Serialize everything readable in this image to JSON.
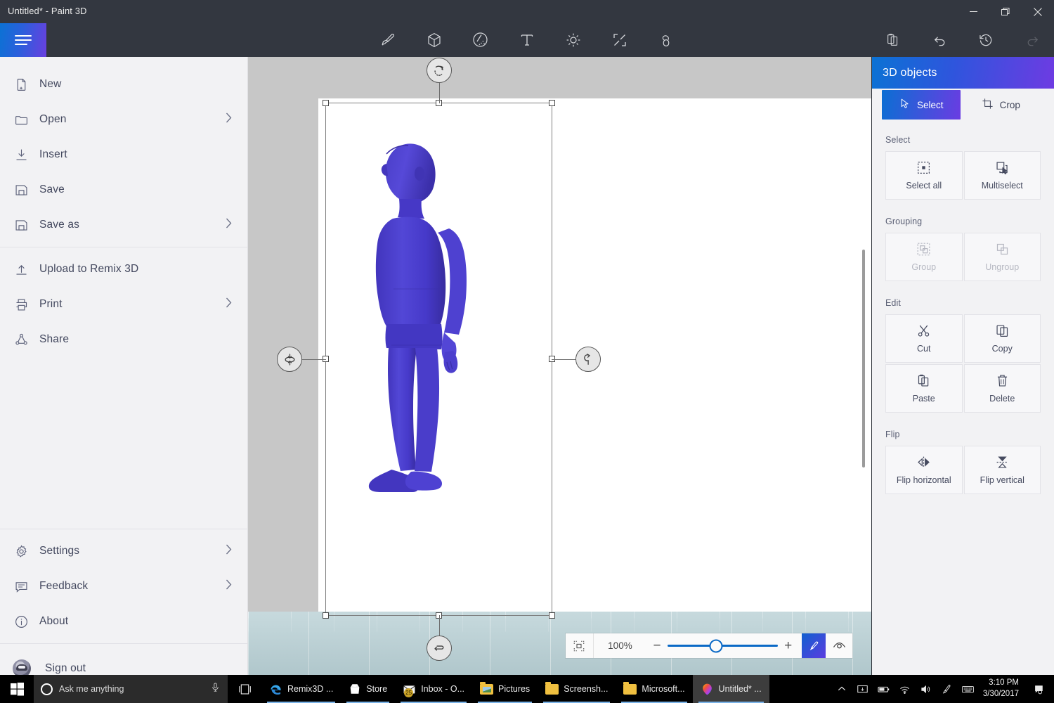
{
  "window": {
    "title": "Untitled* - Paint 3D",
    "minimize_label": "Minimize",
    "maximize_label": "Restore",
    "close_label": "Close"
  },
  "toolbar": {
    "menu_label": "Menu",
    "tools": [
      {
        "name": "art-tools",
        "label": "Art tools"
      },
      {
        "name": "3d-shapes",
        "label": "3D shapes"
      },
      {
        "name": "stickers",
        "label": "Stickers"
      },
      {
        "name": "text",
        "label": "Text"
      },
      {
        "name": "effects",
        "label": "Effects"
      },
      {
        "name": "canvas",
        "label": "Canvas"
      },
      {
        "name": "3d-doodle",
        "label": "3D doodle"
      }
    ],
    "actions": [
      {
        "name": "remix-3d",
        "label": "Remix 3D",
        "disabled": false
      },
      {
        "name": "undo",
        "label": "Undo",
        "disabled": false
      },
      {
        "name": "history",
        "label": "History",
        "disabled": false
      },
      {
        "name": "redo",
        "label": "Redo",
        "disabled": true
      }
    ]
  },
  "menu": {
    "top_items": [
      {
        "label": "New",
        "icon": "new-file-icon",
        "chevron": false
      },
      {
        "label": "Open",
        "icon": "folder-icon",
        "chevron": true
      },
      {
        "label": "Insert",
        "icon": "insert-icon",
        "chevron": false
      },
      {
        "label": "Save",
        "icon": "save-icon",
        "chevron": false
      },
      {
        "label": "Save as",
        "icon": "save-as-icon",
        "chevron": true
      },
      {
        "label": "Upload to Remix 3D",
        "icon": "upload-icon",
        "chevron": false
      },
      {
        "label": "Print",
        "icon": "printer-icon",
        "chevron": true
      },
      {
        "label": "Share",
        "icon": "share-icon",
        "chevron": false
      }
    ],
    "bottom_items": [
      {
        "label": "Settings",
        "icon": "gear-icon",
        "chevron": true
      },
      {
        "label": "Feedback",
        "icon": "feedback-icon",
        "chevron": true
      },
      {
        "label": "About",
        "icon": "info-icon",
        "chevron": false
      }
    ],
    "sign_out_label": "Sign out"
  },
  "canvas": {
    "selection_handles": [
      "top-left",
      "top-middle",
      "top-right",
      "middle-left",
      "middle-right",
      "bottom-left",
      "bottom-middle",
      "bottom-right"
    ],
    "rotation_handles": [
      {
        "name": "rotate-roll-handle",
        "position": "top"
      },
      {
        "name": "rotate-pitch-handle",
        "position": "left"
      },
      {
        "name": "rotate-yaw-handle",
        "position": "right"
      },
      {
        "name": "rotate-flat-handle",
        "position": "bottom"
      }
    ],
    "object": {
      "name": "3d-mannequin",
      "color": "#4a3ec8"
    }
  },
  "zoombar": {
    "fit_label": "Fit to canvas",
    "zoom_value": "100%",
    "zoom_out_label": "−",
    "zoom_in_label": "+",
    "slider_position_pct": 44,
    "pen_label": "2D view",
    "eye_label": "3D view"
  },
  "right_panel": {
    "title": "3D objects",
    "modes": [
      {
        "label": "Select",
        "icon": "cursor-icon",
        "active": true
      },
      {
        "label": "Crop",
        "icon": "crop-icon",
        "active": false
      }
    ],
    "sections": [
      {
        "title": "Select",
        "tiles": [
          {
            "label": "Select all",
            "icon": "select-all-icon",
            "disabled": false
          },
          {
            "label": "Multiselect",
            "icon": "multiselect-icon",
            "disabled": false
          }
        ]
      },
      {
        "title": "Grouping",
        "tiles": [
          {
            "label": "Group",
            "icon": "group-icon",
            "disabled": true
          },
          {
            "label": "Ungroup",
            "icon": "ungroup-icon",
            "disabled": true
          }
        ]
      },
      {
        "title": "Edit",
        "tiles": [
          {
            "label": "Cut",
            "icon": "scissors-icon",
            "disabled": false
          },
          {
            "label": "Copy",
            "icon": "copy-icon",
            "disabled": false
          },
          {
            "label": "Paste",
            "icon": "clipboard-icon",
            "disabled": false
          },
          {
            "label": "Delete",
            "icon": "trash-icon",
            "disabled": false
          }
        ]
      },
      {
        "title": "Flip",
        "tiles": [
          {
            "label": "Flip horizontal",
            "icon": "flip-horizontal-icon",
            "disabled": false
          },
          {
            "label": "Flip vertical",
            "icon": "flip-vertical-icon",
            "disabled": false
          }
        ]
      }
    ]
  },
  "taskbar": {
    "search_placeholder": "Ask me anything",
    "apps": [
      {
        "label": "Remix3D ...",
        "icon": "edge-icon",
        "active": false,
        "running": true
      },
      {
        "label": "Store",
        "icon": "store-icon",
        "active": false,
        "running": true
      },
      {
        "label": "Inbox - O...",
        "icon": "mail-icon",
        "active": false,
        "running": true,
        "badge": "25"
      },
      {
        "label": "Pictures",
        "icon": "folder-pictures-icon",
        "active": false,
        "running": true
      },
      {
        "label": "Screensh...",
        "icon": "folder-icon",
        "active": false,
        "running": true
      },
      {
        "label": "Microsoft...",
        "icon": "folder-icon",
        "active": false,
        "running": true
      },
      {
        "label": "Untitled* ...",
        "icon": "paint3d-icon",
        "active": true,
        "running": true
      }
    ],
    "tray": [
      {
        "name": "show-hidden-icons-icon"
      },
      {
        "name": "project-display-icon"
      },
      {
        "name": "battery-icon"
      },
      {
        "name": "wifi-icon"
      },
      {
        "name": "volume-icon"
      },
      {
        "name": "pen-workspace-icon"
      },
      {
        "name": "touch-keyboard-icon"
      }
    ],
    "time": "3:10 PM",
    "date": "3/30/2017",
    "action_center_label": "Action Center"
  },
  "colors": {
    "accent_blue": "#0b72d4",
    "accent_purple": "#6a3fe0",
    "titlebar": "#333740",
    "panel_bg": "#f2f2f4",
    "model_blue": "#4a3ec8"
  }
}
